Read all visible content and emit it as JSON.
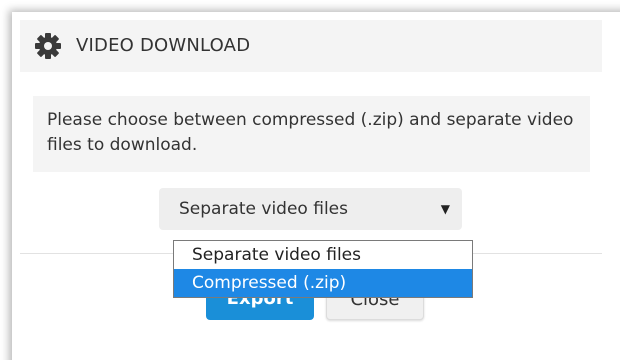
{
  "dialog": {
    "title": "VIDEO DOWNLOAD",
    "title_icon": "gear-icon",
    "message": "Please choose between compressed (.zip) and separate video files to download."
  },
  "format_select": {
    "selected_value": "Separate video files",
    "arrow_icon": "triangle-down-icon",
    "options": [
      {
        "label": "Separate video files"
      },
      {
        "label": "Compressed (.zip)"
      }
    ],
    "highlighted_option_index": 1
  },
  "footer": {
    "export_label": "Export",
    "close_label": "Close"
  },
  "colors": {
    "accent": "#1a8fd8",
    "highlight": "#1e88e5",
    "panel_bg": "#f4f4f4",
    "text": "#333333"
  }
}
